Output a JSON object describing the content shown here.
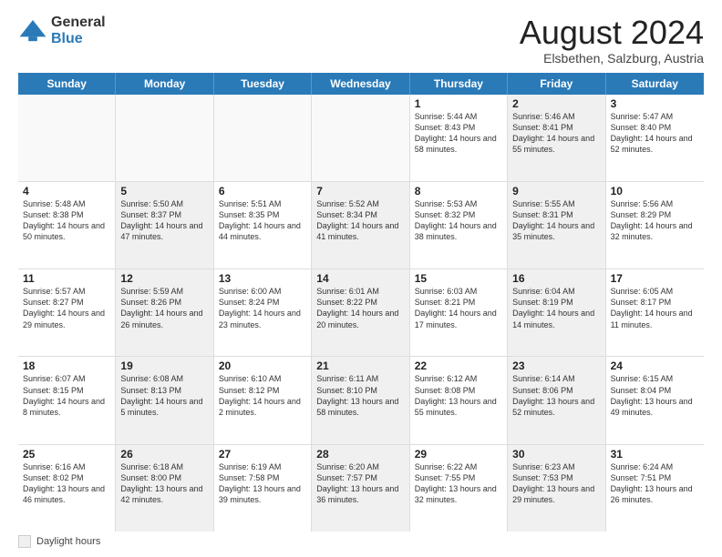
{
  "logo": {
    "general": "General",
    "blue": "Blue"
  },
  "title": "August 2024",
  "subtitle": "Elsbethen, Salzburg, Austria",
  "header_days": [
    "Sunday",
    "Monday",
    "Tuesday",
    "Wednesday",
    "Thursday",
    "Friday",
    "Saturday"
  ],
  "weeks": [
    [
      {
        "day": "",
        "info": "",
        "shaded": false,
        "empty": true
      },
      {
        "day": "",
        "info": "",
        "shaded": false,
        "empty": true
      },
      {
        "day": "",
        "info": "",
        "shaded": false,
        "empty": true
      },
      {
        "day": "",
        "info": "",
        "shaded": false,
        "empty": true
      },
      {
        "day": "1",
        "info": "Sunrise: 5:44 AM\nSunset: 8:43 PM\nDaylight: 14 hours and 58 minutes.",
        "shaded": false,
        "empty": false
      },
      {
        "day": "2",
        "info": "Sunrise: 5:46 AM\nSunset: 8:41 PM\nDaylight: 14 hours and 55 minutes.",
        "shaded": true,
        "empty": false
      },
      {
        "day": "3",
        "info": "Sunrise: 5:47 AM\nSunset: 8:40 PM\nDaylight: 14 hours and 52 minutes.",
        "shaded": false,
        "empty": false
      }
    ],
    [
      {
        "day": "4",
        "info": "Sunrise: 5:48 AM\nSunset: 8:38 PM\nDaylight: 14 hours and 50 minutes.",
        "shaded": false,
        "empty": false
      },
      {
        "day": "5",
        "info": "Sunrise: 5:50 AM\nSunset: 8:37 PM\nDaylight: 14 hours and 47 minutes.",
        "shaded": true,
        "empty": false
      },
      {
        "day": "6",
        "info": "Sunrise: 5:51 AM\nSunset: 8:35 PM\nDaylight: 14 hours and 44 minutes.",
        "shaded": false,
        "empty": false
      },
      {
        "day": "7",
        "info": "Sunrise: 5:52 AM\nSunset: 8:34 PM\nDaylight: 14 hours and 41 minutes.",
        "shaded": true,
        "empty": false
      },
      {
        "day": "8",
        "info": "Sunrise: 5:53 AM\nSunset: 8:32 PM\nDaylight: 14 hours and 38 minutes.",
        "shaded": false,
        "empty": false
      },
      {
        "day": "9",
        "info": "Sunrise: 5:55 AM\nSunset: 8:31 PM\nDaylight: 14 hours and 35 minutes.",
        "shaded": true,
        "empty": false
      },
      {
        "day": "10",
        "info": "Sunrise: 5:56 AM\nSunset: 8:29 PM\nDaylight: 14 hours and 32 minutes.",
        "shaded": false,
        "empty": false
      }
    ],
    [
      {
        "day": "11",
        "info": "Sunrise: 5:57 AM\nSunset: 8:27 PM\nDaylight: 14 hours and 29 minutes.",
        "shaded": false,
        "empty": false
      },
      {
        "day": "12",
        "info": "Sunrise: 5:59 AM\nSunset: 8:26 PM\nDaylight: 14 hours and 26 minutes.",
        "shaded": true,
        "empty": false
      },
      {
        "day": "13",
        "info": "Sunrise: 6:00 AM\nSunset: 8:24 PM\nDaylight: 14 hours and 23 minutes.",
        "shaded": false,
        "empty": false
      },
      {
        "day": "14",
        "info": "Sunrise: 6:01 AM\nSunset: 8:22 PM\nDaylight: 14 hours and 20 minutes.",
        "shaded": true,
        "empty": false
      },
      {
        "day": "15",
        "info": "Sunrise: 6:03 AM\nSunset: 8:21 PM\nDaylight: 14 hours and 17 minutes.",
        "shaded": false,
        "empty": false
      },
      {
        "day": "16",
        "info": "Sunrise: 6:04 AM\nSunset: 8:19 PM\nDaylight: 14 hours and 14 minutes.",
        "shaded": true,
        "empty": false
      },
      {
        "day": "17",
        "info": "Sunrise: 6:05 AM\nSunset: 8:17 PM\nDaylight: 14 hours and 11 minutes.",
        "shaded": false,
        "empty": false
      }
    ],
    [
      {
        "day": "18",
        "info": "Sunrise: 6:07 AM\nSunset: 8:15 PM\nDaylight: 14 hours and 8 minutes.",
        "shaded": false,
        "empty": false
      },
      {
        "day": "19",
        "info": "Sunrise: 6:08 AM\nSunset: 8:13 PM\nDaylight: 14 hours and 5 minutes.",
        "shaded": true,
        "empty": false
      },
      {
        "day": "20",
        "info": "Sunrise: 6:10 AM\nSunset: 8:12 PM\nDaylight: 14 hours and 2 minutes.",
        "shaded": false,
        "empty": false
      },
      {
        "day": "21",
        "info": "Sunrise: 6:11 AM\nSunset: 8:10 PM\nDaylight: 13 hours and 58 minutes.",
        "shaded": true,
        "empty": false
      },
      {
        "day": "22",
        "info": "Sunrise: 6:12 AM\nSunset: 8:08 PM\nDaylight: 13 hours and 55 minutes.",
        "shaded": false,
        "empty": false
      },
      {
        "day": "23",
        "info": "Sunrise: 6:14 AM\nSunset: 8:06 PM\nDaylight: 13 hours and 52 minutes.",
        "shaded": true,
        "empty": false
      },
      {
        "day": "24",
        "info": "Sunrise: 6:15 AM\nSunset: 8:04 PM\nDaylight: 13 hours and 49 minutes.",
        "shaded": false,
        "empty": false
      }
    ],
    [
      {
        "day": "25",
        "info": "Sunrise: 6:16 AM\nSunset: 8:02 PM\nDaylight: 13 hours and 46 minutes.",
        "shaded": false,
        "empty": false
      },
      {
        "day": "26",
        "info": "Sunrise: 6:18 AM\nSunset: 8:00 PM\nDaylight: 13 hours and 42 minutes.",
        "shaded": true,
        "empty": false
      },
      {
        "day": "27",
        "info": "Sunrise: 6:19 AM\nSunset: 7:58 PM\nDaylight: 13 hours and 39 minutes.",
        "shaded": false,
        "empty": false
      },
      {
        "day": "28",
        "info": "Sunrise: 6:20 AM\nSunset: 7:57 PM\nDaylight: 13 hours and 36 minutes.",
        "shaded": true,
        "empty": false
      },
      {
        "day": "29",
        "info": "Sunrise: 6:22 AM\nSunset: 7:55 PM\nDaylight: 13 hours and 32 minutes.",
        "shaded": false,
        "empty": false
      },
      {
        "day": "30",
        "info": "Sunrise: 6:23 AM\nSunset: 7:53 PM\nDaylight: 13 hours and 29 minutes.",
        "shaded": true,
        "empty": false
      },
      {
        "day": "31",
        "info": "Sunrise: 6:24 AM\nSunset: 7:51 PM\nDaylight: 13 hours and 26 minutes.",
        "shaded": false,
        "empty": false
      }
    ]
  ],
  "footer": {
    "legend_label": "Daylight hours"
  }
}
